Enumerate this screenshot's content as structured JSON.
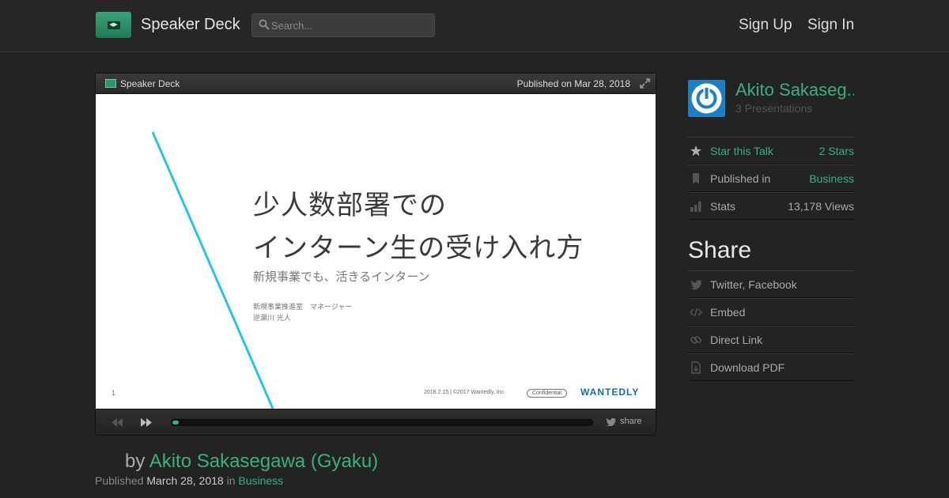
{
  "header": {
    "brand": "Speaker Deck",
    "search_placeholder": "Search...",
    "sign_up": "Sign Up",
    "sign_in": "Sign In"
  },
  "player": {
    "brand": "Speaker Deck",
    "published": "Published on Mar 28, 2018",
    "progress_fraction": 0.015,
    "share_label": "share"
  },
  "slide": {
    "title_line1": "少人数部署での",
    "title_line2": "インターン生の受け入れ方",
    "subtitle": "新規事業でも、活きるインターン",
    "role": "新規事業推進室　マネージャー",
    "name": "逆瀬川 光人",
    "page_number": "1",
    "footer": "2018.2.15 | ©2017 Wantedly, Inc.",
    "confidential": "Confidential",
    "logo_text": "WANTEDLY"
  },
  "talk": {
    "by_prefix": "by",
    "author": "Akito Sakasegawa (Gyaku)",
    "published_prefix": "Published",
    "date": "March 28, 2018",
    "in_word": "in",
    "category": "Business"
  },
  "sidebar": {
    "author_name": "Akito Sakaseg...",
    "presentations": "3 Presentations",
    "rows": [
      {
        "label": "Star this Talk",
        "value": "2 Stars"
      },
      {
        "label": "Published in",
        "value": "Business"
      },
      {
        "label": "Stats",
        "value": "13,178 Views"
      }
    ],
    "share_title": "Share",
    "share_items": [
      {
        "label": "Twitter, Facebook"
      },
      {
        "label": "Embed"
      },
      {
        "label": "Direct Link"
      },
      {
        "label": "Download PDF"
      }
    ]
  },
  "colors": {
    "accent_green": "#3bb07f",
    "background": "#232323",
    "avatar_blue": "#1e7fc2",
    "slide_line": "#29c3e6"
  }
}
